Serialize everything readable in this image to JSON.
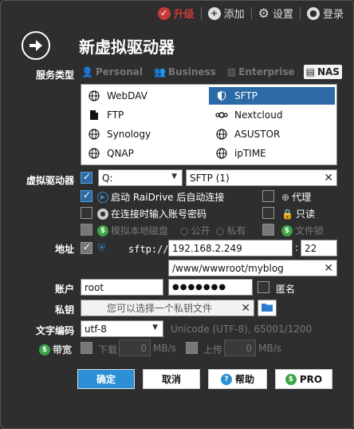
{
  "topbar": {
    "upgrade_label": "升级",
    "add_label": "添加",
    "settings_label": "设置",
    "login_label": "登录"
  },
  "header": {
    "title": "新虚拟驱动器"
  },
  "service_type": {
    "label": "服务类型",
    "tabs": [
      "Personal",
      "Business",
      "Enterprise",
      "NAS"
    ],
    "selected_tab": "NAS",
    "services": [
      "WebDAV",
      "SFTP",
      "FTP",
      "Nextcloud",
      "Synology",
      "ASUSTOR",
      "QNAP",
      "ipTIME"
    ],
    "selected_service": "SFTP"
  },
  "virtual_drive": {
    "label": "虚拟驱动器",
    "drive_letter": "Q:",
    "drive_name": "SFTP (1)",
    "options": {
      "auto_connect": "启动 RaiDrive 后自动连接",
      "proxy": "代理",
      "ask_password": "在连接时输入账号密码",
      "readonly": "只读",
      "local_disk": "模拟本地磁盘",
      "public": "公开",
      "private": "私有",
      "file_lock": "文件锁"
    }
  },
  "address": {
    "label": "地址",
    "scheme": "sftp://",
    "host": "192.168.2.249",
    "port_sep": ":",
    "port": "22",
    "path": "/www/wwwroot/myblog"
  },
  "account": {
    "label": "账户",
    "username": "root",
    "password": "●●●●●●●",
    "anonymous": "匿名"
  },
  "private_key": {
    "label": "私钥",
    "placeholder": "您可以选择一个私钥文件"
  },
  "encoding": {
    "label": "文字编码",
    "value": "utf-8",
    "description": "Unicode (UTF-8), 65001/1200"
  },
  "bandwidth": {
    "label": "带宽",
    "download_label": "下载",
    "download_value": "0",
    "upload_label": "上传",
    "upload_value": "0",
    "unit": "MB/s"
  },
  "buttons": {
    "ok": "确定",
    "cancel": "取消",
    "help": "帮助",
    "pro": "PRO"
  },
  "colors": {
    "accent": "#2b6aa6",
    "primary_button": "#2d8fd5",
    "upgrade": "#c83a3a",
    "pro_badge": "#3aa545"
  }
}
